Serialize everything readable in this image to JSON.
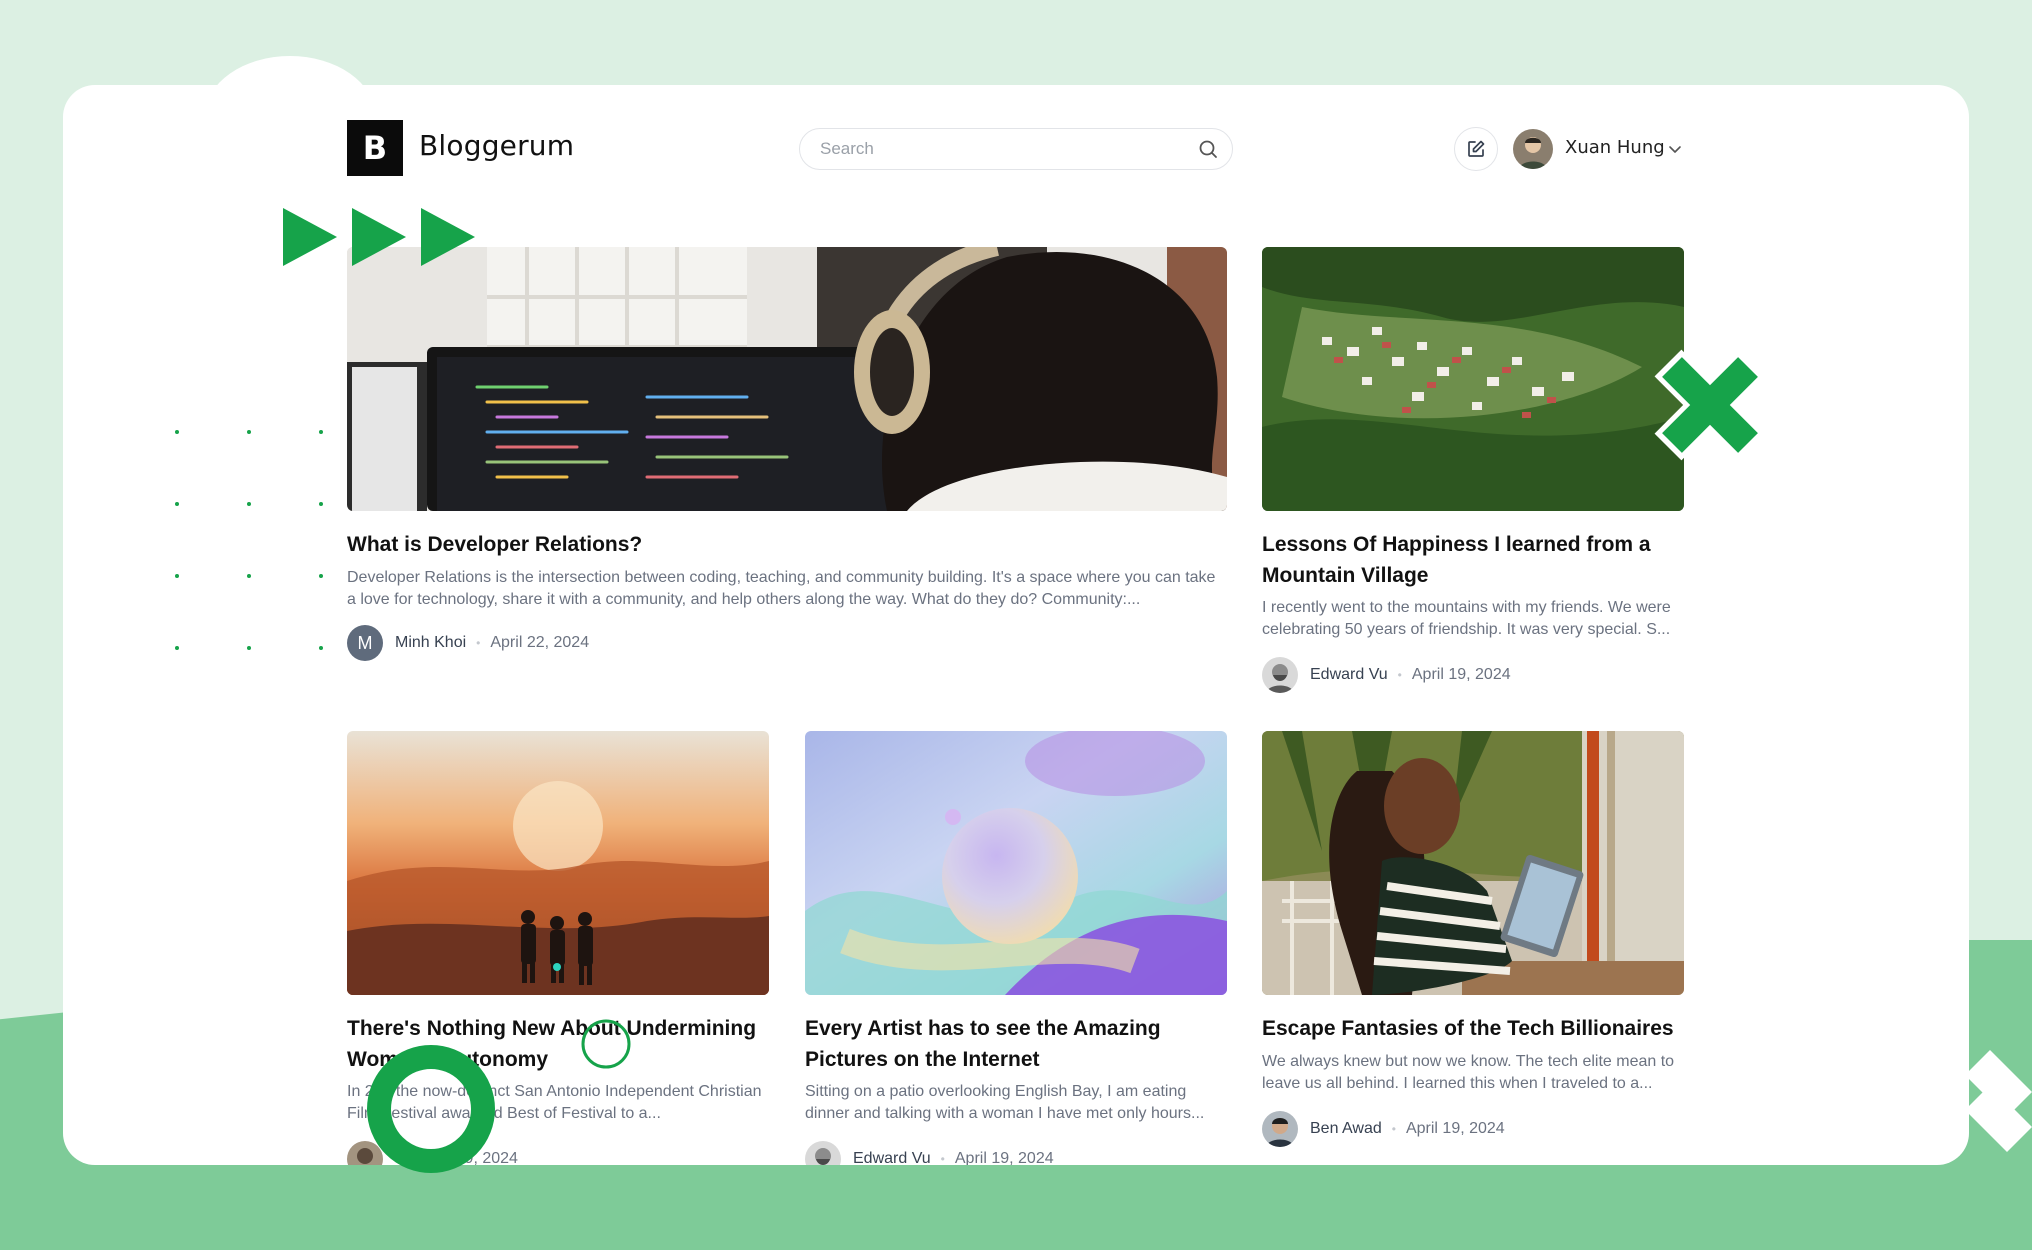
{
  "brand": {
    "logo_letter": "B",
    "name": "Bloggerum"
  },
  "search": {
    "placeholder": "Search"
  },
  "user": {
    "name": "Xuan Hung"
  },
  "posts": [
    {
      "title": "What is Developer Relations?",
      "excerpt": "Developer Relations is the intersection between coding, teaching, and community building. It's a space where you can take a love for technology, share it with a community, and help others along the way. What do they do? Community:...",
      "author": "Minh Khoi",
      "author_initial": "M",
      "date": "April 22, 2024"
    },
    {
      "title": "Lessons Of Happiness I learned from a Mountain Village",
      "excerpt": "I recently went to the mountains with my friends. We were celebrating 50 years of friendship. It was very special. S...",
      "author": "Edward Vu",
      "date": "April 19, 2024"
    },
    {
      "title": "There's Nothing New About Undermining Women's Autonomy",
      "excerpt": "In 2..., the now-defunct San Antonio Independent Christian Film Festival awarded Best of Festival to a...",
      "author": "",
      "date": "April 19, 2024"
    },
    {
      "title": "Every Artist has to see the Amazing Pictures on the Internet",
      "excerpt": "Sitting on a patio overlooking English Bay, I am eating dinner and talking with a woman I have met only hours...",
      "author": "Edward Vu",
      "date": "April 19, 2024"
    },
    {
      "title": "Escape Fantasies of the Tech Billionaires",
      "excerpt": "We always knew but now we know. The tech elite mean to leave us all behind. I learned this when I traveled to a...",
      "author": "Ben Awad",
      "date": "April 19, 2024"
    }
  ],
  "meta_separator": "•",
  "colors": {
    "accent_green": "#16a34a",
    "background": "#dcf0e3",
    "band": "#7ecb98"
  }
}
